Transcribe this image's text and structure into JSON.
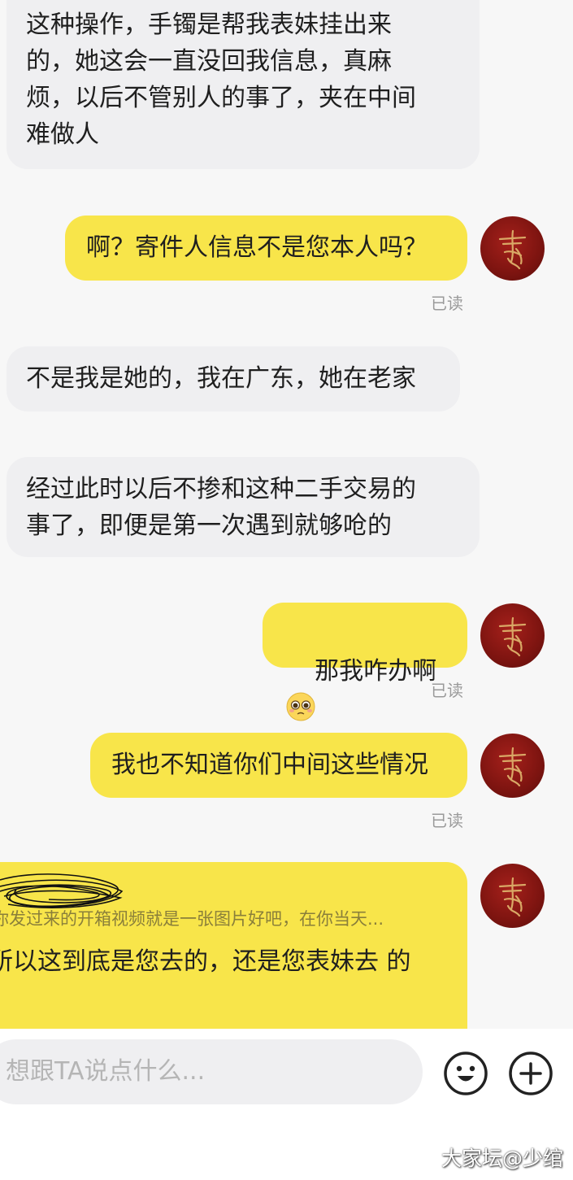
{
  "messages": [
    {
      "side": "in",
      "text": "这种操作，手镯是帮我表妹挂出来\n的，她这会一直没回我信息，真麻\n烦，以后不管别人的事了，夹在中间\n难做人"
    },
    {
      "side": "out",
      "text": "啊？寄件人信息不是您本人吗？",
      "read": "已读"
    },
    {
      "side": "in",
      "text": "不是我是她的，我在广东，她在老家"
    },
    {
      "side": "in",
      "text": "经过此时以后不掺和这种二手交易的\n事了，即便是第一次遇到就够呛的"
    },
    {
      "side": "out",
      "text": "那我咋办啊",
      "emoji": "pleading-face-emoji",
      "read": "已读"
    },
    {
      "side": "out",
      "text": "我也不知道你们中间这些情况",
      "read": "已读"
    }
  ],
  "quoted_reply": {
    "quote": "你发过来的开箱视频就是一张图片好吧，在你当天...",
    "text": "所以这到底是您去的，还是您表妹去\n的"
  },
  "input": {
    "placeholder": "想跟TA说点什么..."
  },
  "icons": {
    "emoji_button": "smiley-icon",
    "plus_button": "plus-icon",
    "avatar": "red-calligraphy-avatar"
  },
  "colors": {
    "outgoing_bubble": "#f8e54a",
    "incoming_bubble": "#efeff1",
    "background": "#f7f7f7"
  },
  "watermark": "大家坛@少绾"
}
